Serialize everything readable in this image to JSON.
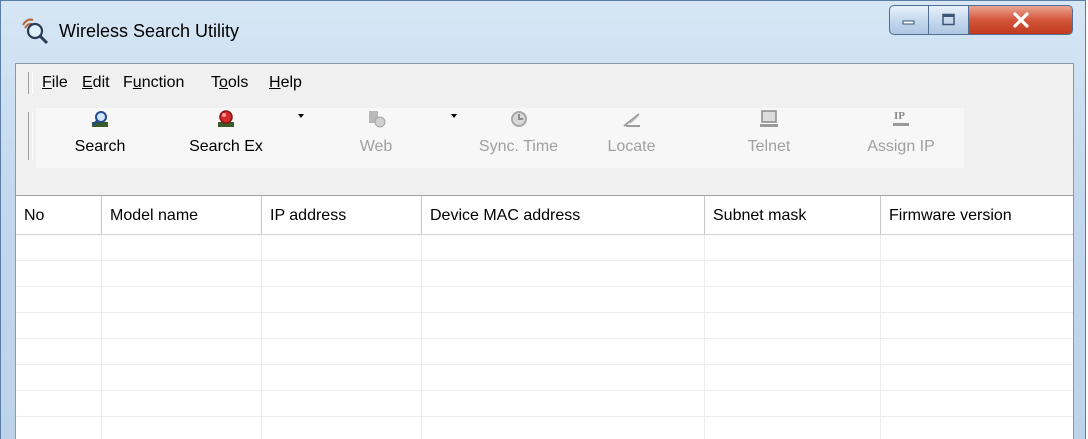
{
  "window": {
    "title": "Wireless Search Utility"
  },
  "title_buttons": {
    "minimize": "minimize",
    "maximize": "maximize",
    "close": "close"
  },
  "menu": [
    {
      "label": "File",
      "mnemonic": "F"
    },
    {
      "label": "Edit",
      "mnemonic": "E"
    },
    {
      "label": "Function",
      "mnemonic": "u"
    },
    {
      "label": "Tools",
      "mnemonic": "o"
    },
    {
      "label": "Help",
      "mnemonic": "H"
    }
  ],
  "toolbar": [
    {
      "label": "Search",
      "icon": "search-icon",
      "enabled": true
    },
    {
      "label": "Search Ex",
      "icon": "search-ex-icon",
      "enabled": true,
      "dropdown": true
    },
    {
      "label": "Web",
      "icon": "web-icon",
      "enabled": false,
      "dropdown": true
    },
    {
      "label": "Sync. Time",
      "icon": "sync-time-icon",
      "enabled": false
    },
    {
      "label": "Locate",
      "icon": "locate-icon",
      "enabled": false
    },
    {
      "label": "Telnet",
      "icon": "telnet-icon",
      "enabled": false
    },
    {
      "label": "Assign IP",
      "icon": "assign-ip-icon",
      "enabled": false
    }
  ],
  "table": {
    "columns": [
      "No",
      "Model name",
      "IP address",
      "Device MAC address",
      "Subnet mask",
      "Firmware version"
    ],
    "rows": []
  },
  "colors": {
    "title_close": "#c8432a",
    "frame": "#c3d8ee",
    "disabled_text": "#a0a0a0"
  }
}
